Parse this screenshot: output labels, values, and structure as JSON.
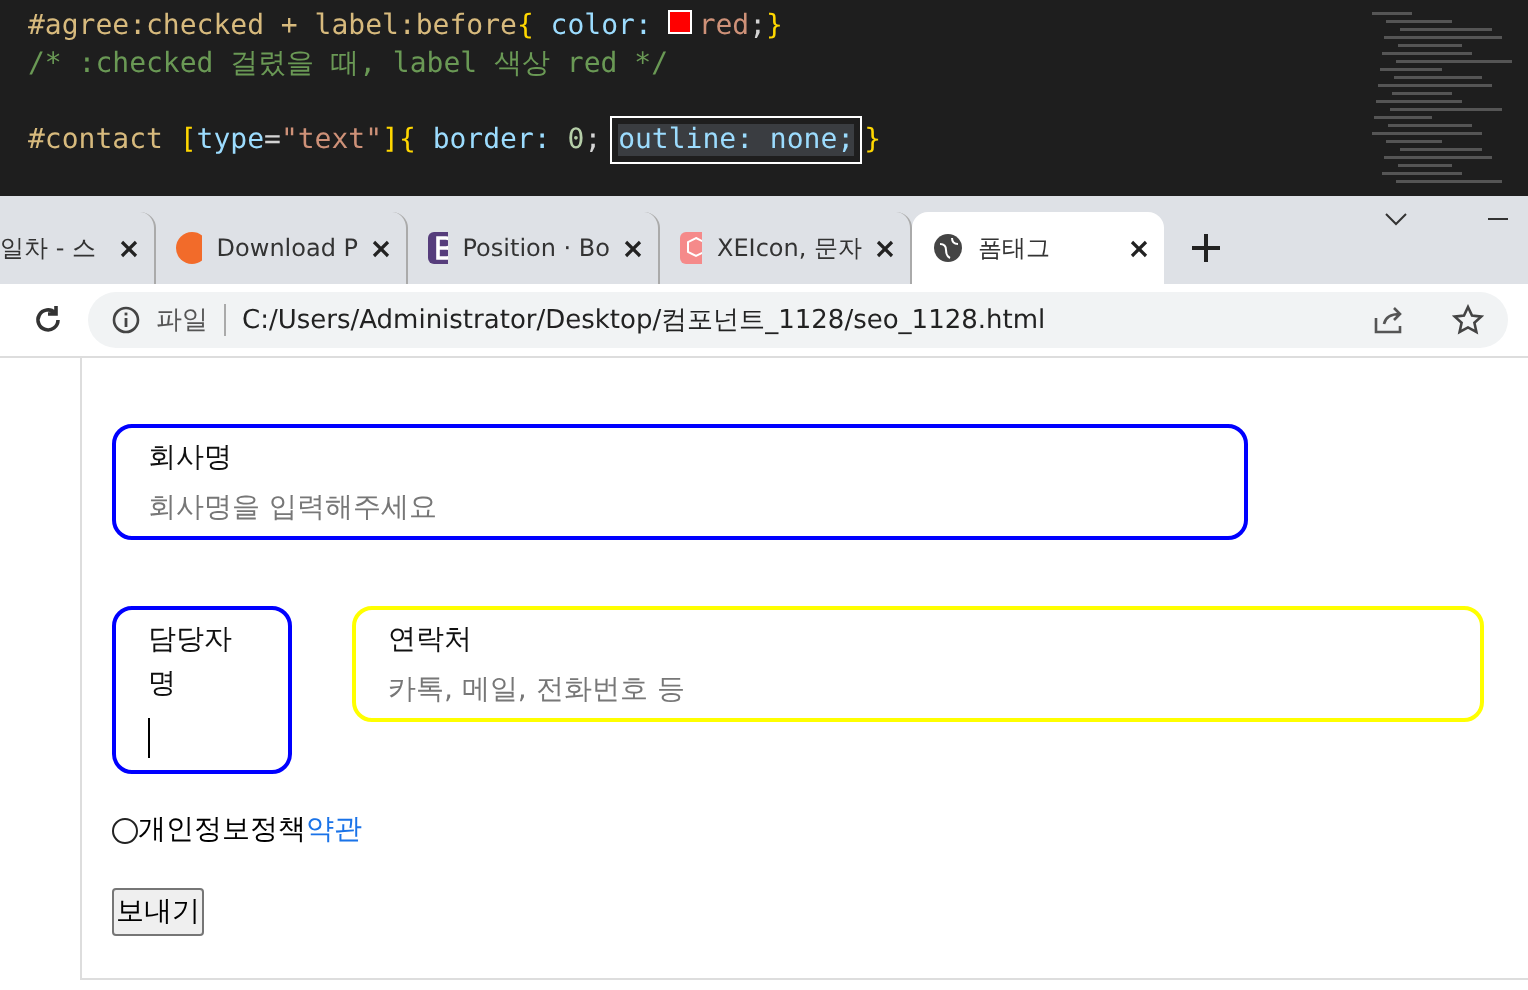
{
  "editor": {
    "lines": [
      [
        {
          "kind": "selector",
          "text": "#agree:checked + label:before"
        },
        {
          "kind": "brace",
          "text": "{ "
        },
        {
          "kind": "prop",
          "text": "color: "
        },
        {
          "kind": "swatch",
          "color": "#ff0000"
        },
        {
          "kind": "value",
          "text": "red"
        },
        {
          "kind": "plain",
          "text": ";"
        },
        {
          "kind": "brace",
          "text": "}"
        }
      ],
      [
        {
          "kind": "comment",
          "text": "/* :checked 걸렸을 때, label 색상 red */"
        }
      ],
      [
        {
          "kind": "selector",
          "text": "#contact "
        },
        {
          "kind": "brace",
          "text": "["
        },
        {
          "kind": "prop",
          "text": "type"
        },
        {
          "kind": "plain",
          "text": "="
        },
        {
          "kind": "value",
          "text": "\"text\""
        },
        {
          "kind": "brace",
          "text": "]{ "
        },
        {
          "kind": "prop",
          "text": "border: "
        },
        {
          "kind": "number",
          "text": "0"
        },
        {
          "kind": "plain",
          "text": "; "
        },
        {
          "kind": "highlight",
          "text": "outline: none;"
        },
        {
          "kind": "brace",
          "text": "}"
        }
      ]
    ]
  },
  "tabs": [
    {
      "label": "일차 - 스",
      "selected": false
    },
    {
      "label": "Download P",
      "selected": false
    },
    {
      "label": "Position · Bo",
      "selected": false
    },
    {
      "label": "XEIcon, 문자",
      "selected": false
    },
    {
      "label": "폼태그",
      "selected": true
    }
  ],
  "address": {
    "scheme": "파일",
    "url": "C:/Users/Administrator/Desktop/컴포넌트_1128/seo_1128.html"
  },
  "form": {
    "fields": [
      {
        "label": "회사명",
        "placeholder": "회사명을 입력해주세요",
        "color": "#0000ff",
        "focused": false
      },
      {
        "label": "담당자명",
        "color": "#0000ff",
        "focused": true
      },
      {
        "label": "연락처",
        "placeholder": "카톡, 메일, 전화번호 등",
        "color": "#ffff00",
        "focused": false
      }
    ],
    "agree": {
      "label": "개인정보정책",
      "link": "약관",
      "checked": false
    },
    "submit": "보내기"
  }
}
